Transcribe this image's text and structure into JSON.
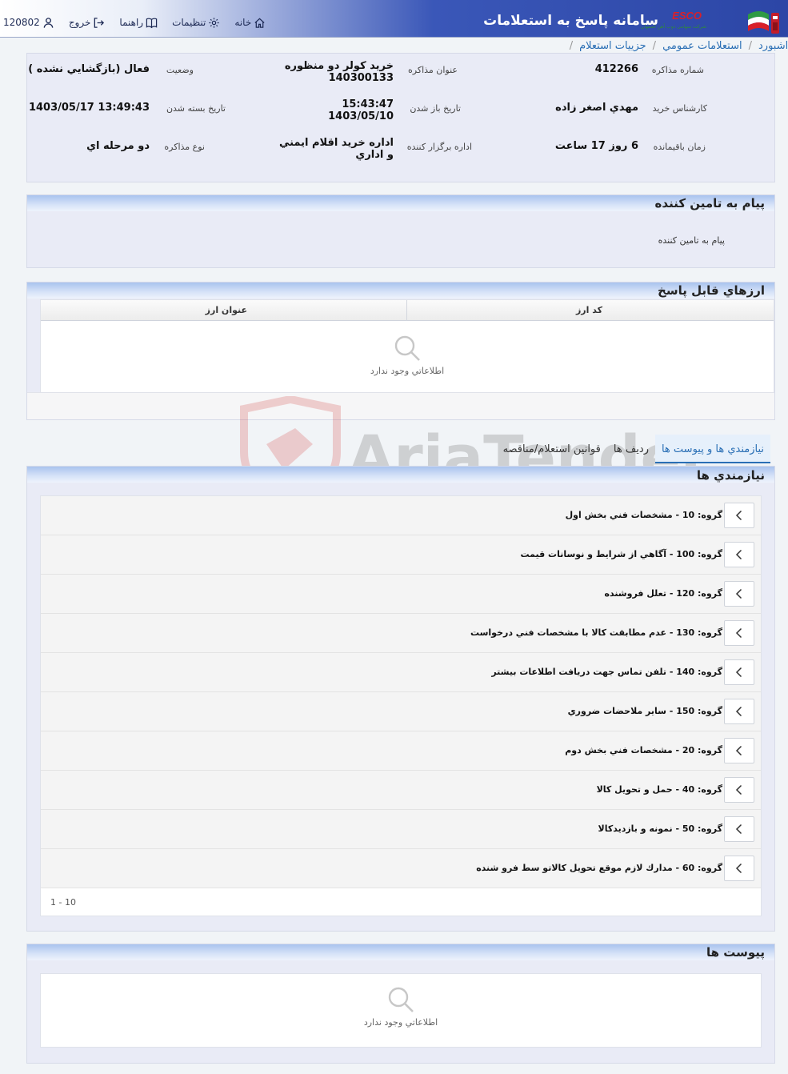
{
  "header": {
    "user_id": "120802",
    "logout_label": "خروج",
    "help_label": "راهنما",
    "settings_label": "تنظيمات",
    "home_label": "خانه",
    "app_title": "سامانه پاسخ به استعلامات",
    "brand": "ESCO",
    "brand_sub": "شرکت سهامی ذوب آهن اصفهان"
  },
  "breadcrumb": {
    "dashboard": "داشبورد",
    "public": "استعلامات عمومي",
    "current": "جزييات استعلام"
  },
  "info": {
    "number_label": "شماره مذاکره",
    "number_value": "412266",
    "subject_label": "عنوان مذاکره",
    "subject_value_line1": "خريد کولر دو منظوره",
    "subject_value_line2": "140300133",
    "status_label": "وضعيت",
    "status_value": "فعال (بازگشايي نشده )",
    "expert_label": "کارشناس خريد",
    "expert_value": "مهدي اصغر زاده",
    "open_label": "تاريخ باز شدن",
    "open_value_time": "15:43:47",
    "open_value_date": "1403/05/10",
    "close_label": "تاريخ بسته شدن",
    "close_value": "1403/05/17 13:49:43",
    "remaining_label": "زمان باقيمانده",
    "remaining_value": "6 روز 17 ساعت",
    "dept_label": "اداره برگزار کننده",
    "dept_value_line1": "اداره خريد اقلام ايمني",
    "dept_value_line2": "و اداري",
    "type_label": "نوع مذاکره",
    "type_value": "دو مرحله اي"
  },
  "supplier_message": {
    "title": "پيام به تامين کننده",
    "text": "پيام به تامين کننده"
  },
  "currencies": {
    "title": "ارزهاي قابل پاسخ",
    "col_code": "کد ارز",
    "col_title": "عنوان ارز",
    "empty": "اطلاعاتي وجود ندارد"
  },
  "tabs": [
    {
      "label": "نيازمندي ها و پيوست ها",
      "active": true
    },
    {
      "label": "رديف ها",
      "active": false
    },
    {
      "label": "قوانين استعلام/مناقصه",
      "active": false
    }
  ],
  "requirements": {
    "title": "نيازمندي ها",
    "rows": [
      "گروه: 10 - مشخصات فني بخش اول",
      "گروه: 100 - آگاهي از شرايط و نوسانات قيمت",
      "گروه: 120 - تعلل فروشنده",
      "گروه: 130 - عدم مطابقت کالا با مشخصات فني درخواست",
      "گروه: 140 - تلفن تماس جهت دريافت اطلاعات بيشتر",
      "گروه: 150 - ساير ملاحضات ضروري",
      "گروه: 20 - مشخصات فني بخش دوم",
      "گروه: 40 - حمل و تحويل کالا",
      "گروه: 50 - نمونه و بازديدکالا",
      "گروه: 60 - مدارك لازم موقع تحويل كالاتو سط فرو شنده"
    ],
    "pager": "1 - 10"
  },
  "attachments": {
    "title": "پيوست ها",
    "empty": "اطلاعاتي وجود ندارد"
  },
  "watermark": "AriaTender.neT",
  "colors": {
    "accent": "#2a6fb5",
    "header_dark": "#2c46a6",
    "panel_bg": "#e9ebf6"
  }
}
